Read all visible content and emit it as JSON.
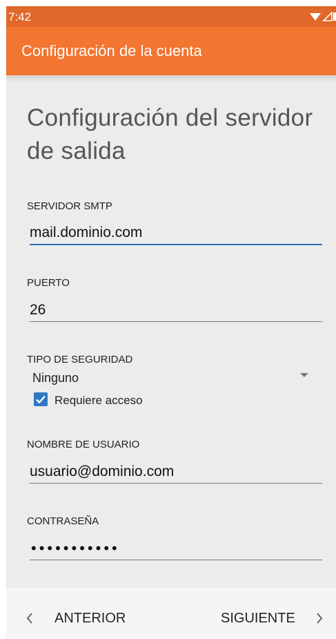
{
  "status_bar": {
    "time": "7:42",
    "icons": [
      "wifi-icon",
      "signal-icon",
      "battery-icon"
    ]
  },
  "app_bar": {
    "title": "Configuración de la cuenta"
  },
  "page": {
    "heading": "Configuración del servidor de salida"
  },
  "fields": {
    "smtp": {
      "label": "SERVIDOR SMTP",
      "value": "mail.dominio.com"
    },
    "port": {
      "label": "PUERTO",
      "value": "26"
    },
    "security": {
      "label": "TIPO DE SEGURIDAD",
      "value": "Ninguno"
    },
    "requires_login": {
      "label": "Requiere acceso",
      "checked": true
    },
    "username": {
      "label": "NOMBRE DE USUARIO",
      "value": "usuario@dominio.com"
    },
    "password": {
      "label": "CONTRASEÑA",
      "value": "•••••••••••"
    }
  },
  "nav": {
    "previous": "ANTERIOR",
    "next": "SIGUIENTE"
  },
  "colors": {
    "status_bar": "#e2672b",
    "app_bar": "#f27530",
    "accent": "#2f78c4"
  }
}
